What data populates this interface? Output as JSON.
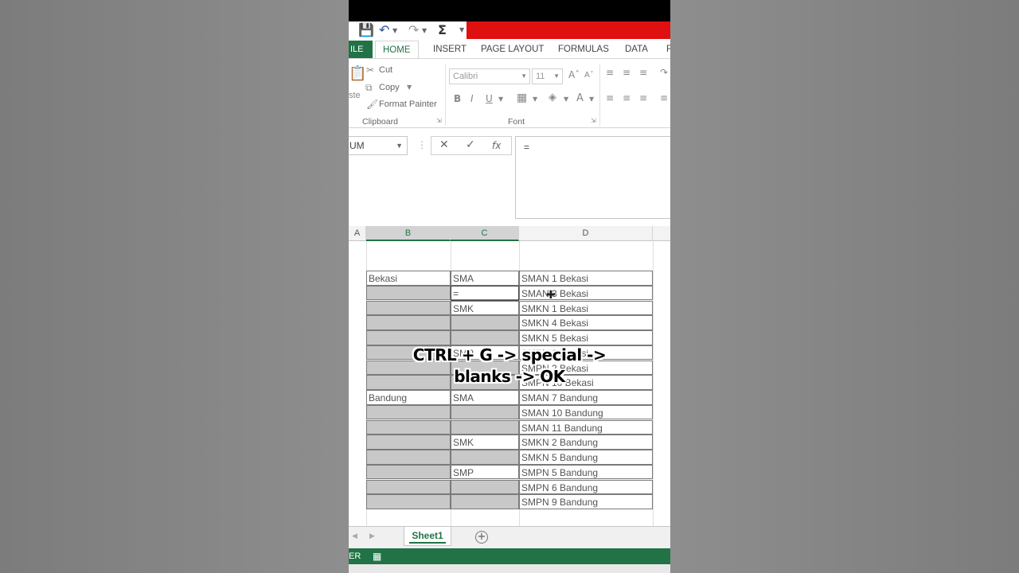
{
  "overlay": {
    "line1": "CTRL + G -> special ->",
    "line2": "blanks -> OK"
  },
  "ribbon_tabs": {
    "file": "ILE",
    "home": "HOME",
    "insert": "INSERT",
    "page_layout": "PAGE LAYOUT",
    "formulas": "FORMULAS",
    "data": "DATA",
    "more": "R"
  },
  "clipboard": {
    "cut": "Cut",
    "copy": "Copy",
    "format_painter": "Format Painter",
    "paste_partial": "ste",
    "group_label": "Clipboard"
  },
  "font": {
    "name": "Calibri",
    "size": "11",
    "group_label": "Font"
  },
  "formula_bar": {
    "name_box": "UM",
    "formula": "="
  },
  "columns": [
    "A",
    "B",
    "C",
    "D"
  ],
  "rows": [
    {
      "b": "Bekasi",
      "c": "SMA",
      "d": "SMAN 1 Bekasi",
      "b_blank": false,
      "c_blank": false
    },
    {
      "b": "",
      "c": "=",
      "d": "SMAN 3 Bekasi",
      "b_blank": true,
      "c_blank": false
    },
    {
      "b": "",
      "c": "SMK",
      "d": "SMKN 1 Bekasi",
      "b_blank": true,
      "c_blank": false
    },
    {
      "b": "",
      "c": "",
      "d": "SMKN 4 Bekasi",
      "b_blank": true,
      "c_blank": true
    },
    {
      "b": "",
      "c": "",
      "d": "SMKN 5 Bekasi",
      "b_blank": true,
      "c_blank": true
    },
    {
      "b": "",
      "c": "SMP",
      "d": "SMPN 1 Bekasi",
      "b_blank": true,
      "c_blank": false
    },
    {
      "b": "",
      "c": "",
      "d": "SMPN 2 Bekasi",
      "b_blank": true,
      "c_blank": true
    },
    {
      "b": "",
      "c": "",
      "d": "SMPN 10 Bekasi",
      "b_blank": true,
      "c_blank": true
    },
    {
      "b": "Bandung",
      "c": "SMA",
      "d": "SMAN 7 Bandung",
      "b_blank": false,
      "c_blank": false
    },
    {
      "b": "",
      "c": "",
      "d": "SMAN 10 Bandung",
      "b_blank": true,
      "c_blank": true
    },
    {
      "b": "",
      "c": "",
      "d": "SMAN 11 Bandung",
      "b_blank": true,
      "c_blank": true
    },
    {
      "b": "",
      "c": "SMK",
      "d": "SMKN 2 Bandung",
      "b_blank": true,
      "c_blank": false
    },
    {
      "b": "",
      "c": "",
      "d": "SMKN 5 Bandung",
      "b_blank": true,
      "c_blank": true
    },
    {
      "b": "",
      "c": "SMP",
      "d": "SMPN 5 Bandung",
      "b_blank": true,
      "c_blank": false
    },
    {
      "b": "",
      "c": "",
      "d": "SMPN 6 Bandung",
      "b_blank": true,
      "c_blank": true
    },
    {
      "b": "",
      "c": "",
      "d": "SMPN 9 Bandung",
      "b_blank": true,
      "c_blank": true
    }
  ],
  "sheet": {
    "tab": "Sheet1",
    "status_mode": "ER"
  },
  "colors": {
    "excel_green": "#217346",
    "red_bar": "#e01010",
    "blank_fill": "#c8c8c8"
  },
  "icons": [
    "save-icon",
    "undo-icon",
    "redo-icon",
    "sum-icon",
    "cut-icon",
    "copy-icon",
    "format-painter-icon",
    "add-sheet-icon",
    "fill-handle-cursor-icon"
  ]
}
